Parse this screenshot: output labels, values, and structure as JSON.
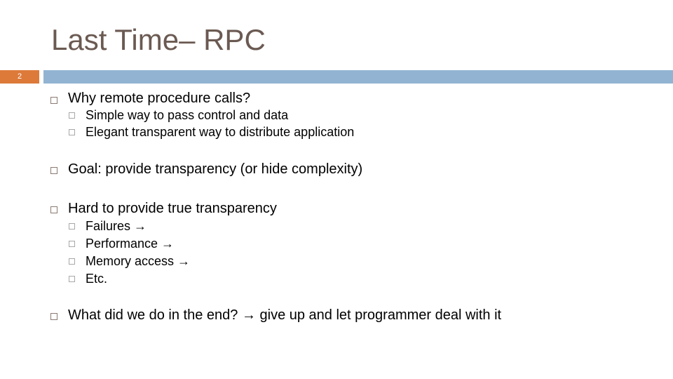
{
  "slide": {
    "title": "Last Time– RPC",
    "number": "2",
    "colors": {
      "accent_orange": "#dd7a3a",
      "accent_blue": "#92b4d2",
      "title": "#6b5a52"
    },
    "bullets": [
      {
        "text": "Why remote procedure calls?",
        "subs": [
          "Simple way to pass control and data",
          "Elegant transparent way to distribute application"
        ]
      },
      {
        "text": "Goal: provide transparency (or hide complexity)",
        "subs": []
      },
      {
        "text": "Hard to provide true transparency",
        "subs": [
          "Failures →",
          "Performance  →",
          "Memory access  →",
          "Etc."
        ]
      },
      {
        "text": "What did we do in the end? → give up and let programmer deal with it",
        "subs": []
      }
    ]
  }
}
